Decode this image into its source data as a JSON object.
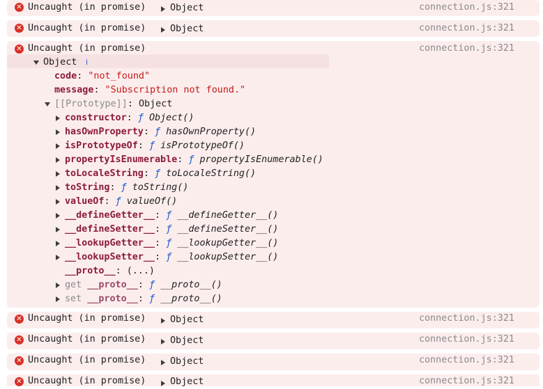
{
  "console": {
    "messages_before": [
      {
        "text": "Uncaught (in promise)",
        "object": "Object",
        "source": "connection.js:321"
      },
      {
        "text": "Uncaught (in promise)",
        "object": "Object",
        "source": "connection.js:321"
      }
    ],
    "expanded": {
      "text": "Uncaught (in promise)",
      "source": "connection.js:321",
      "object_label": "Object",
      "info_icon": "i",
      "properties": [
        {
          "key": "code",
          "value": "\"not_found\""
        },
        {
          "key": "message",
          "value": "\"Subscription not found.\""
        }
      ],
      "prototype": {
        "label": "[[Prototype]]",
        "value": "Object",
        "members": [
          {
            "key": "constructor",
            "f": "ƒ",
            "fn": "Object()"
          },
          {
            "key": "hasOwnProperty",
            "f": "ƒ",
            "fn": "hasOwnProperty()"
          },
          {
            "key": "isPrototypeOf",
            "f": "ƒ",
            "fn": "isPrototypeOf()"
          },
          {
            "key": "propertyIsEnumerable",
            "f": "ƒ",
            "fn": "propertyIsEnumerable()"
          },
          {
            "key": "toLocaleString",
            "f": "ƒ",
            "fn": "toLocaleString()"
          },
          {
            "key": "toString",
            "f": "ƒ",
            "fn": "toString()"
          },
          {
            "key": "valueOf",
            "f": "ƒ",
            "fn": "valueOf()"
          },
          {
            "key": "__defineGetter__",
            "f": "ƒ",
            "fn": "__defineGetter__()"
          },
          {
            "key": "__defineSetter__",
            "f": "ƒ",
            "fn": "__defineSetter__()"
          },
          {
            "key": "__lookupGetter__",
            "f": "ƒ",
            "fn": "__lookupGetter__()"
          },
          {
            "key": "__lookupSetter__",
            "f": "ƒ",
            "fn": "__lookupSetter__()"
          }
        ],
        "proto_getter": {
          "key": "__proto__",
          "value": "(...)"
        },
        "accessors": [
          {
            "prefix": "get",
            "key": "__proto__",
            "f": "ƒ",
            "fn": "__proto__()"
          },
          {
            "prefix": "set",
            "key": "__proto__",
            "f": "ƒ",
            "fn": "__proto__()"
          }
        ]
      }
    },
    "messages_after": [
      {
        "text": "Uncaught (in promise)",
        "object": "Object",
        "source": "connection.js:321"
      },
      {
        "text": "Uncaught (in promise)",
        "object": "Object",
        "source": "connection.js:321"
      },
      {
        "text": "Uncaught (in promise)",
        "object": "Object",
        "source": "connection.js:321"
      },
      {
        "text": "Uncaught (in promise)",
        "object": "Object",
        "source": "connection.js:321"
      }
    ],
    "colors": {
      "error_bg": "#fceded",
      "error_icon": "#d93025",
      "key": "#8a1b3b",
      "string": "#c41a16",
      "function_marker": "#1a58c9",
      "source_link": "#8a8a8a"
    }
  }
}
